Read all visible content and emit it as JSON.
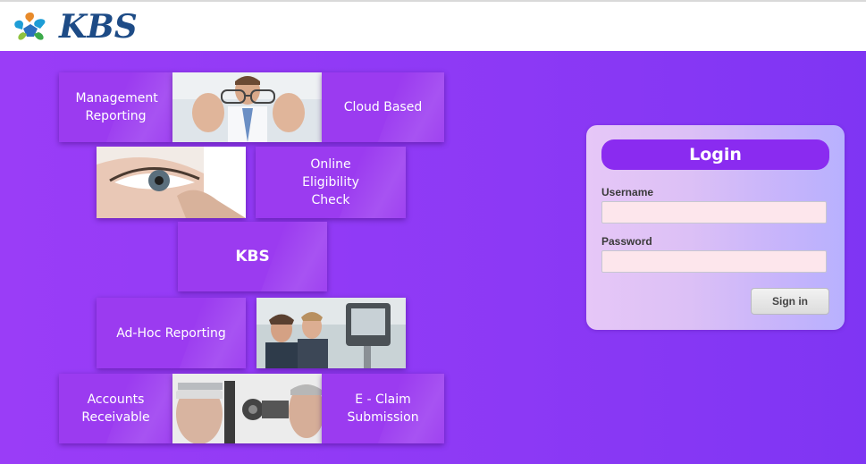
{
  "header": {
    "logo_text": "KBS"
  },
  "tiles": {
    "management_reporting": "Management Reporting",
    "cloud_based": "Cloud Based",
    "online_eligibility": "Online Eligibility Check",
    "kbs": "KBS",
    "adhoc_reporting": "Ad-Hoc Reporting",
    "accounts_receivable": "Accounts Receivable",
    "eclaim": "E - Claim Submission"
  },
  "login": {
    "title": "Login",
    "username_label": "Username",
    "username_value": "",
    "password_label": "Password",
    "password_value": "",
    "signin_label": "Sign in"
  },
  "colors": {
    "brand": "#1d4b86",
    "hero": "#8c39f5",
    "tile": "#9b3bf0",
    "login_header": "#8a2bf0",
    "input_bg": "#fde6ec"
  }
}
